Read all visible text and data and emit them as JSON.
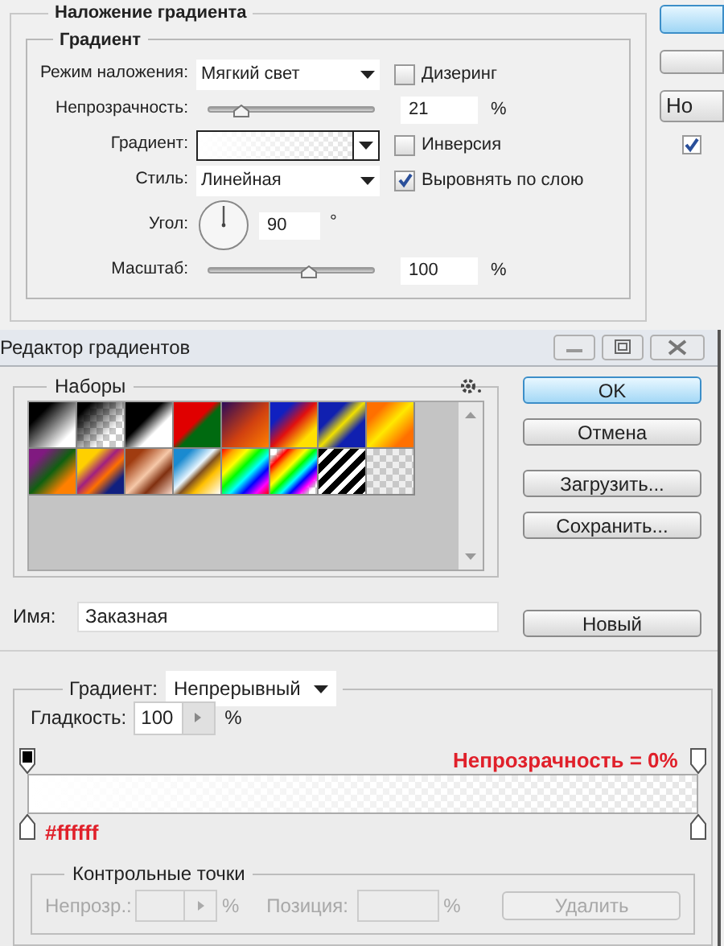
{
  "layer_style": {
    "title": "Наложение градиента",
    "group": "Градиент",
    "rows": [
      {
        "kind": "select",
        "label": "Режим наложения:",
        "value": "Мягкий свет",
        "checkbox": {
          "label": "Дизеринг",
          "checked": false
        }
      },
      {
        "kind": "slider",
        "label": "Непрозрачность:",
        "level": 0.2,
        "value": "21",
        "unit": "%"
      },
      {
        "kind": "gradient",
        "label": "Градиент:",
        "checkbox": {
          "label": "Инверсия",
          "checked": false
        }
      },
      {
        "kind": "select",
        "label": "Стиль:",
        "value": "Линейная",
        "checkbox": {
          "label": "Выровнять по слою",
          "checked": true
        }
      },
      {
        "kind": "angle",
        "label": "Угол:",
        "value": "90",
        "unit": "°"
      },
      {
        "kind": "slider",
        "label": "Масштаб:",
        "level": 0.61,
        "value": "100",
        "unit": "%"
      }
    ],
    "side": {
      "button_text": "Но",
      "checkbox": {
        "checked": true
      }
    }
  },
  "gradient_editor": {
    "title": "Редактор градиентов",
    "presets": {
      "title": "Наборы"
    },
    "buttons": [
      {
        "label": "OK",
        "default": true
      },
      {
        "label": "Отмена",
        "default": false
      },
      {
        "label": "Загрузить...",
        "default": false
      },
      {
        "label": "Сохранить...",
        "default": false
      }
    ],
    "name": {
      "label": "Имя:",
      "value": "Заказная",
      "button": "Новый"
    },
    "gradient": {
      "type_label": "Градиент:",
      "type_value": "Непрерывный",
      "smoothness_label": "Гладкость:",
      "smoothness_value": "100",
      "smoothness_unit": "%",
      "opacity_stops": [
        {
          "kind": "opaque"
        },
        {
          "kind": "transparent"
        }
      ],
      "opacity_note": "Непрозрачность = 0%",
      "color_note": "#ffffff"
    },
    "control_points": {
      "title": "Контрольные точки",
      "disabled": true,
      "opacity_label": "Непрозр.:",
      "opacity_unit": "%",
      "position_label": "Позиция:",
      "position_unit": "%",
      "delete_button": "Удалить"
    }
  }
}
